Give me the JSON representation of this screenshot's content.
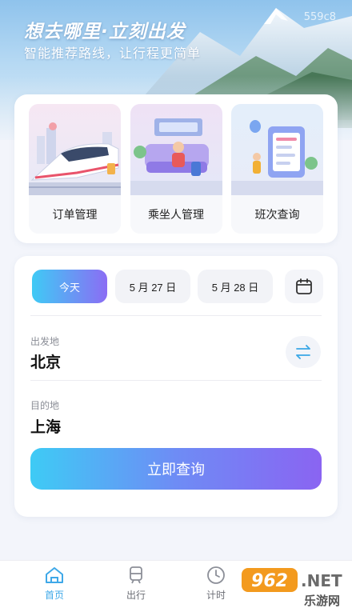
{
  "hero": {
    "title": "想去哪里·立刻出发",
    "subtitle": "智能推荐路线，让行程更简单",
    "watermark": "559c8"
  },
  "services": [
    {
      "label": "订单管理",
      "icon": "train-illustration"
    },
    {
      "label": "乘坐人管理",
      "icon": "passenger-seat-illustration"
    },
    {
      "label": "班次查询",
      "icon": "schedule-board-illustration"
    }
  ],
  "search": {
    "dates": {
      "today": "今天",
      "date1": "5 月 27 日",
      "date2": "5 月 28 日"
    },
    "calendar_icon": "calendar-icon",
    "departure": {
      "label": "出发地",
      "value": "北京"
    },
    "destination": {
      "label": "目的地",
      "value": "上海"
    },
    "swap_icon": "swap-arrows-icon",
    "submit_label": "立即查询"
  },
  "tabbar": {
    "items": [
      {
        "label": "首页",
        "icon": "home-icon",
        "active": true
      },
      {
        "label": "出行",
        "icon": "train-icon",
        "active": false
      },
      {
        "label": "计时",
        "icon": "clock-icon",
        "active": false
      }
    ]
  },
  "site_logo": {
    "number": "962",
    "net": ".NET",
    "text": "乐游网"
  },
  "colors": {
    "accent_start": "#3fcaf5",
    "accent_end": "#8a64f2",
    "active_tab": "#3ea8e8",
    "background": "#f3f5fb"
  }
}
